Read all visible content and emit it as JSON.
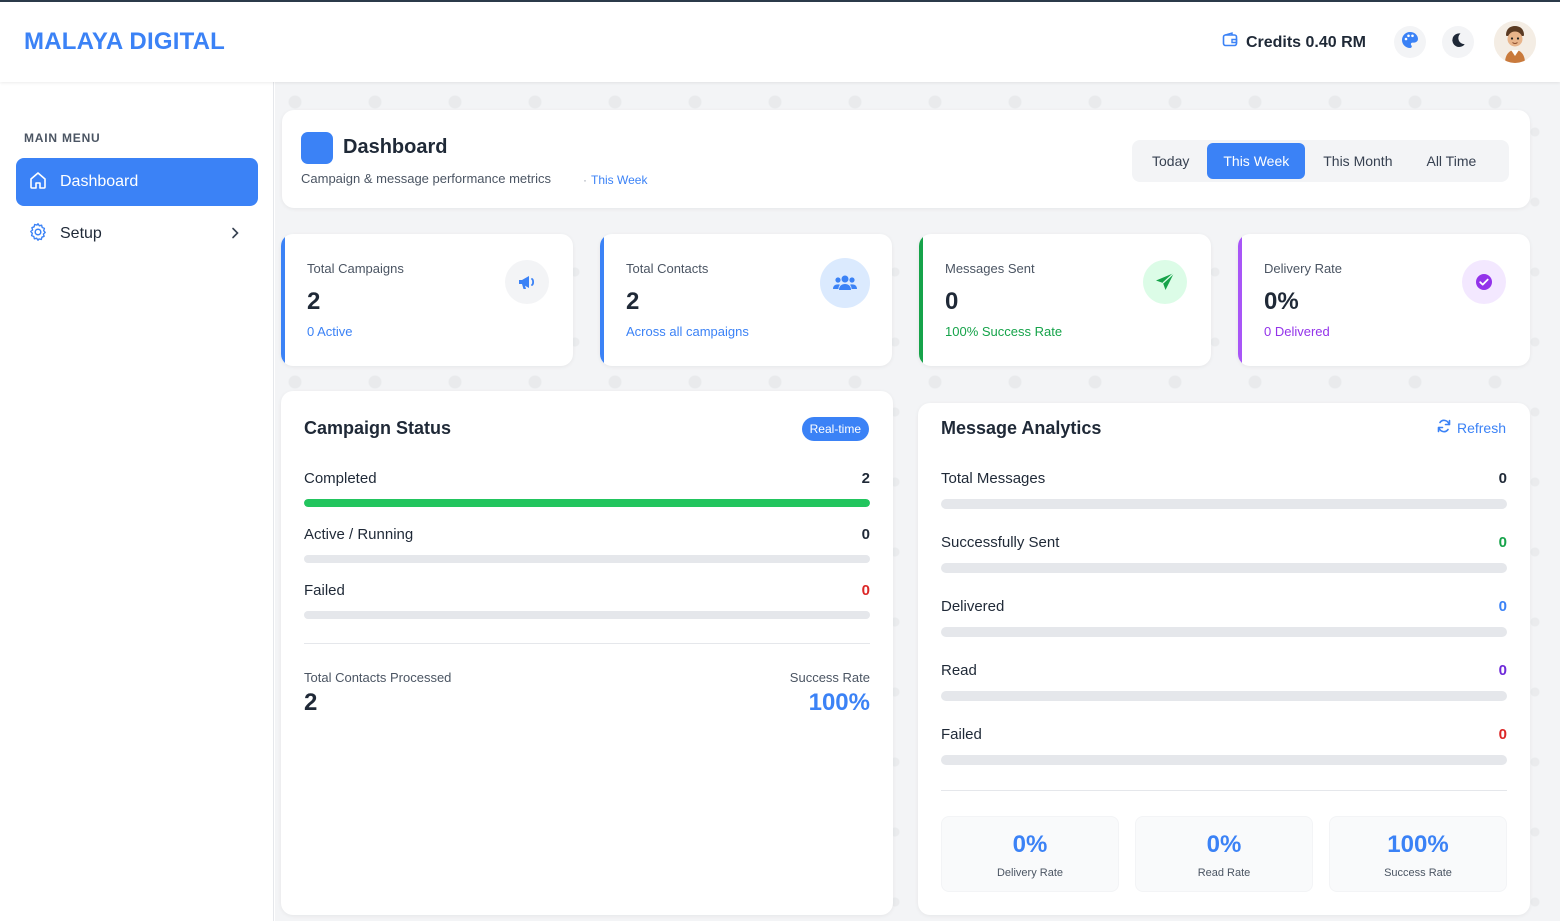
{
  "header": {
    "logo": "MALAYA DIGITAL",
    "credits": "Credits 0.40 RM"
  },
  "sidebar": {
    "menu_title": "MAIN MENU",
    "items": [
      {
        "label": "Dashboard",
        "icon": "home-icon",
        "active": true
      },
      {
        "label": "Setup",
        "icon": "gear-icon",
        "active": false
      }
    ]
  },
  "page": {
    "title": "Dashboard",
    "subtitle": "Campaign & message performance metrics",
    "period_tag": "This Week",
    "periods": [
      {
        "label": "Today",
        "active": false
      },
      {
        "label": "This Week",
        "active": true
      },
      {
        "label": "This Month",
        "active": false
      },
      {
        "label": "All Time",
        "active": false
      }
    ]
  },
  "stats": [
    {
      "label": "Total Campaigns",
      "value": "2",
      "sub": "0 Active",
      "color": "#3b82f6",
      "icon": "megaphone-icon"
    },
    {
      "label": "Total Contacts",
      "value": "2",
      "sub": "Across all campaigns",
      "color": "#3b82f6",
      "icon": "users-icon"
    },
    {
      "label": "Messages Sent",
      "value": "0",
      "sub": "100% Success Rate",
      "color": "#16a34a",
      "icon": "paper-plane-icon"
    },
    {
      "label": "Delivery Rate",
      "value": "0%",
      "sub": "0 Delivered",
      "color": "#a855f7",
      "icon": "check-circle-icon"
    }
  ],
  "campaign_status": {
    "title": "Campaign Status",
    "badge": "Real-time",
    "rows": [
      {
        "label": "Completed",
        "value": "2",
        "fraction": 1.0,
        "color": "#22c55e",
        "value_color": "#1f2937"
      },
      {
        "label": "Active / Running",
        "value": "0",
        "fraction": 0,
        "color": "#3b82f6",
        "value_color": "#1f2937"
      },
      {
        "label": "Failed",
        "value": "0",
        "fraction": 0,
        "color": "#ef4444",
        "value_color": "#dc2626"
      }
    ],
    "total_label": "Total Contacts Processed",
    "total_value": "2",
    "success_label": "Success Rate",
    "success_value": "100%"
  },
  "message_analytics": {
    "title": "Message Analytics",
    "refresh_label": "Refresh",
    "rows": [
      {
        "label": "Total Messages",
        "value": "0",
        "fraction": 0,
        "value_color": "#1f2937"
      },
      {
        "label": "Successfully Sent",
        "value": "0",
        "fraction": 0,
        "value_color": "#16a34a"
      },
      {
        "label": "Delivered",
        "value": "0",
        "fraction": 0,
        "value_color": "#3b82f6"
      },
      {
        "label": "Read",
        "value": "0",
        "fraction": 0,
        "value_color": "#6d28d9"
      },
      {
        "label": "Failed",
        "value": "0",
        "fraction": 0,
        "value_color": "#dc2626"
      }
    ],
    "summary": [
      {
        "value": "0%",
        "label": "Delivery Rate"
      },
      {
        "value": "0%",
        "label": "Read Rate"
      },
      {
        "value": "100%",
        "label": "Success Rate"
      }
    ]
  }
}
